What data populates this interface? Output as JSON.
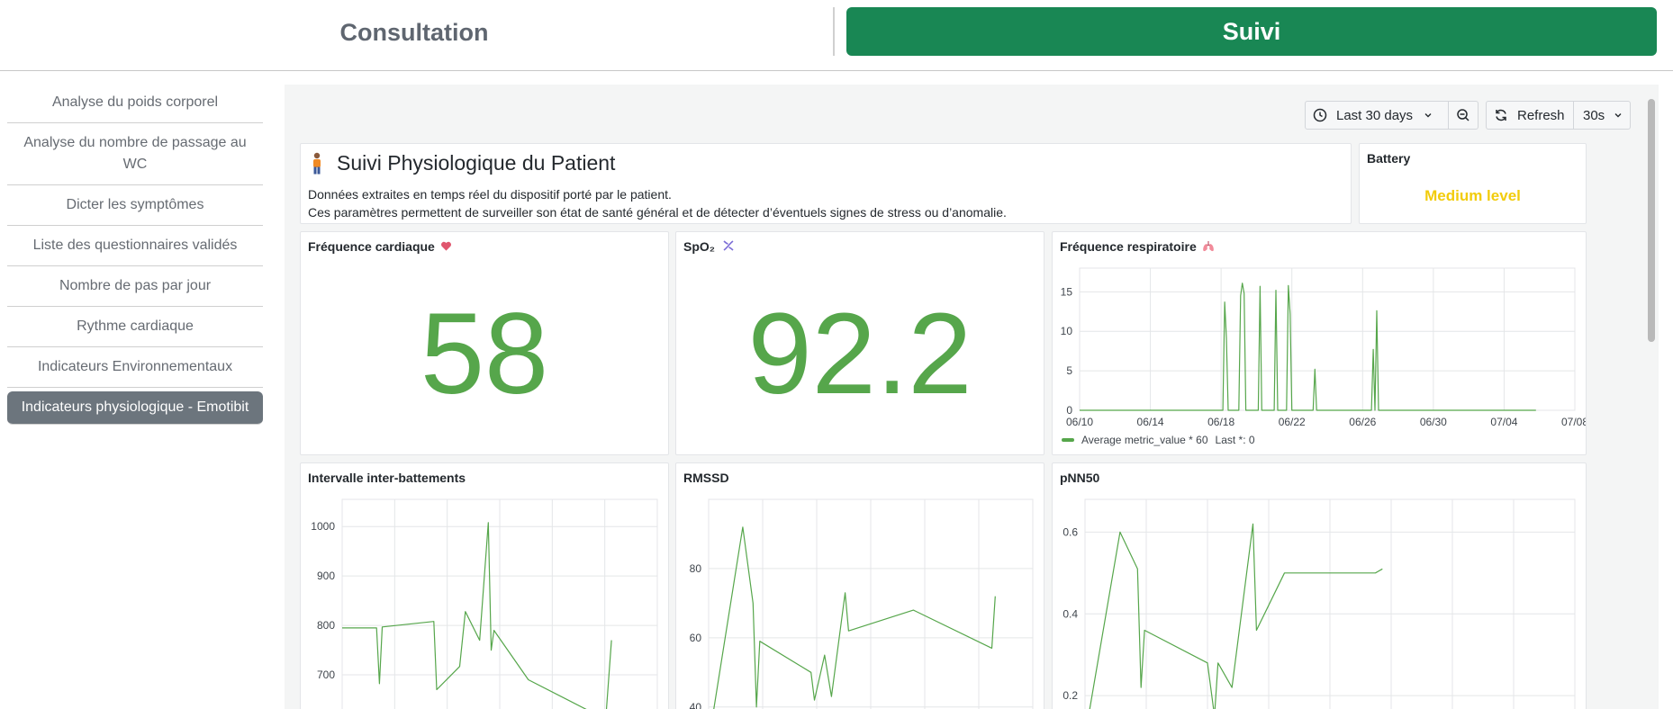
{
  "tabs": {
    "consultation": "Consultation",
    "suivi": "Suivi"
  },
  "sidebar": {
    "items": [
      "Analyse du poids corporel",
      "Analyse du nombre de passage au WC",
      "Dicter les symptômes",
      "Liste des questionnaires validés",
      "Nombre de pas par jour",
      "Rythme cardiaque",
      "Indicateurs Environnementaux",
      "Indicateurs physiologique - Emotibit"
    ],
    "active_index": 7
  },
  "toolbar": {
    "time_range": "Last 30 days",
    "refresh_label": "Refresh",
    "refresh_interval": "30s"
  },
  "header_panel": {
    "icon": "person-icon",
    "title": "Suivi Physiologique du Patient",
    "line1": "Données extraites en temps réel du dispositif porté par le patient.",
    "line2": "Ces paramètres permettent de surveiller son état de santé général et de détecter d’éventuels signes de stress ou d’anomalie."
  },
  "battery": {
    "title": "Battery",
    "value": "Medium level",
    "color": "#f2cc0c"
  },
  "stats": {
    "heart_rate": {
      "title": "Fréquence cardiaque",
      "icon": "heart-icon",
      "value": "58"
    },
    "spo2": {
      "title": "SpO₂",
      "icon": "dna-icon",
      "value": "92.2"
    }
  },
  "colors": {
    "series": "#56a64b",
    "accent": "#198754",
    "grid": "#e4e6e8"
  },
  "chart_data": [
    {
      "type": "line",
      "title": "Fréquence respiratoire",
      "title_icon": "lungs-icon",
      "x_ticks": [
        "06/10",
        "06/14",
        "06/18",
        "06/22",
        "06/26",
        "06/30",
        "07/04",
        "07/08"
      ],
      "y_ticks": [
        0,
        5,
        10,
        15
      ],
      "ylim": [
        0,
        18
      ],
      "series": [
        {
          "name": "Average metric_value * 60",
          "legend_extra": "Last *: 0",
          "points": [
            [
              0,
              0
            ],
            [
              8.1,
              0
            ],
            [
              8.2,
              13.7
            ],
            [
              8.3,
              9.2
            ],
            [
              8.4,
              0
            ],
            [
              9.0,
              0
            ],
            [
              9.1,
              14.5
            ],
            [
              9.2,
              16.1
            ],
            [
              9.3,
              14.8
            ],
            [
              9.4,
              0
            ],
            [
              10.1,
              0
            ],
            [
              10.2,
              15.7
            ],
            [
              10.3,
              0
            ],
            [
              11.0,
              0
            ],
            [
              11.1,
              15.2
            ],
            [
              11.2,
              0
            ],
            [
              11.7,
              0
            ],
            [
              11.8,
              15.8
            ],
            [
              11.9,
              12.2
            ],
            [
              12.0,
              0
            ],
            [
              13.2,
              0
            ],
            [
              13.3,
              5.2
            ],
            [
              13.4,
              0
            ],
            [
              16.5,
              0
            ],
            [
              16.6,
              7.7
            ],
            [
              16.7,
              0
            ],
            [
              16.8,
              12.6
            ],
            [
              16.9,
              0
            ],
            [
              25.8,
              0
            ]
          ]
        }
      ]
    },
    {
      "type": "line",
      "title": "Intervalle inter-battements",
      "y_ticks": [
        700,
        800,
        900,
        1000
      ],
      "ylim": [
        600,
        1055
      ],
      "series": [
        {
          "points": [
            [
              0,
              795
            ],
            [
              1.2,
              795
            ],
            [
              1.3,
              682
            ],
            [
              1.4,
              797
            ],
            [
              3.2,
              808
            ],
            [
              3.3,
              670
            ],
            [
              4.1,
              717
            ],
            [
              4.3,
              828
            ],
            [
              4.8,
              770
            ],
            [
              5.1,
              1008
            ],
            [
              5.2,
              750
            ],
            [
              5.3,
              790
            ],
            [
              6.5,
              690
            ],
            [
              9.2,
              610
            ],
            [
              9.4,
              770
            ]
          ]
        }
      ]
    },
    {
      "type": "line",
      "title": "RMSSD",
      "y_ticks": [
        40,
        60,
        80
      ],
      "ylim": [
        35,
        100
      ],
      "series": [
        {
          "points": [
            [
              0,
              30
            ],
            [
              1.0,
              92
            ],
            [
              1.3,
              70
            ],
            [
              1.4,
              40
            ],
            [
              1.5,
              59
            ],
            [
              3.0,
              50
            ],
            [
              3.1,
              42
            ],
            [
              3.4,
              55
            ],
            [
              3.6,
              43
            ],
            [
              4.0,
              73
            ],
            [
              4.1,
              62
            ],
            [
              6.0,
              68
            ],
            [
              8.3,
              57
            ],
            [
              8.4,
              72
            ]
          ]
        }
      ]
    },
    {
      "type": "line",
      "title": "pNN50",
      "y_ticks": [
        0.2,
        0.4,
        0.6
      ],
      "ylim": [
        0.13,
        0.68
      ],
      "series": [
        {
          "points": [
            [
              0,
              0.1
            ],
            [
              1.0,
              0.6
            ],
            [
              1.5,
              0.51
            ],
            [
              1.6,
              0.22
            ],
            [
              1.7,
              0.36
            ],
            [
              3.5,
              0.28
            ],
            [
              3.7,
              0.15
            ],
            [
              3.8,
              0.28
            ],
            [
              4.2,
              0.22
            ],
            [
              4.8,
              0.62
            ],
            [
              4.9,
              0.36
            ],
            [
              5.7,
              0.5
            ],
            [
              8.3,
              0.5
            ],
            [
              8.5,
              0.51
            ]
          ]
        }
      ]
    }
  ]
}
